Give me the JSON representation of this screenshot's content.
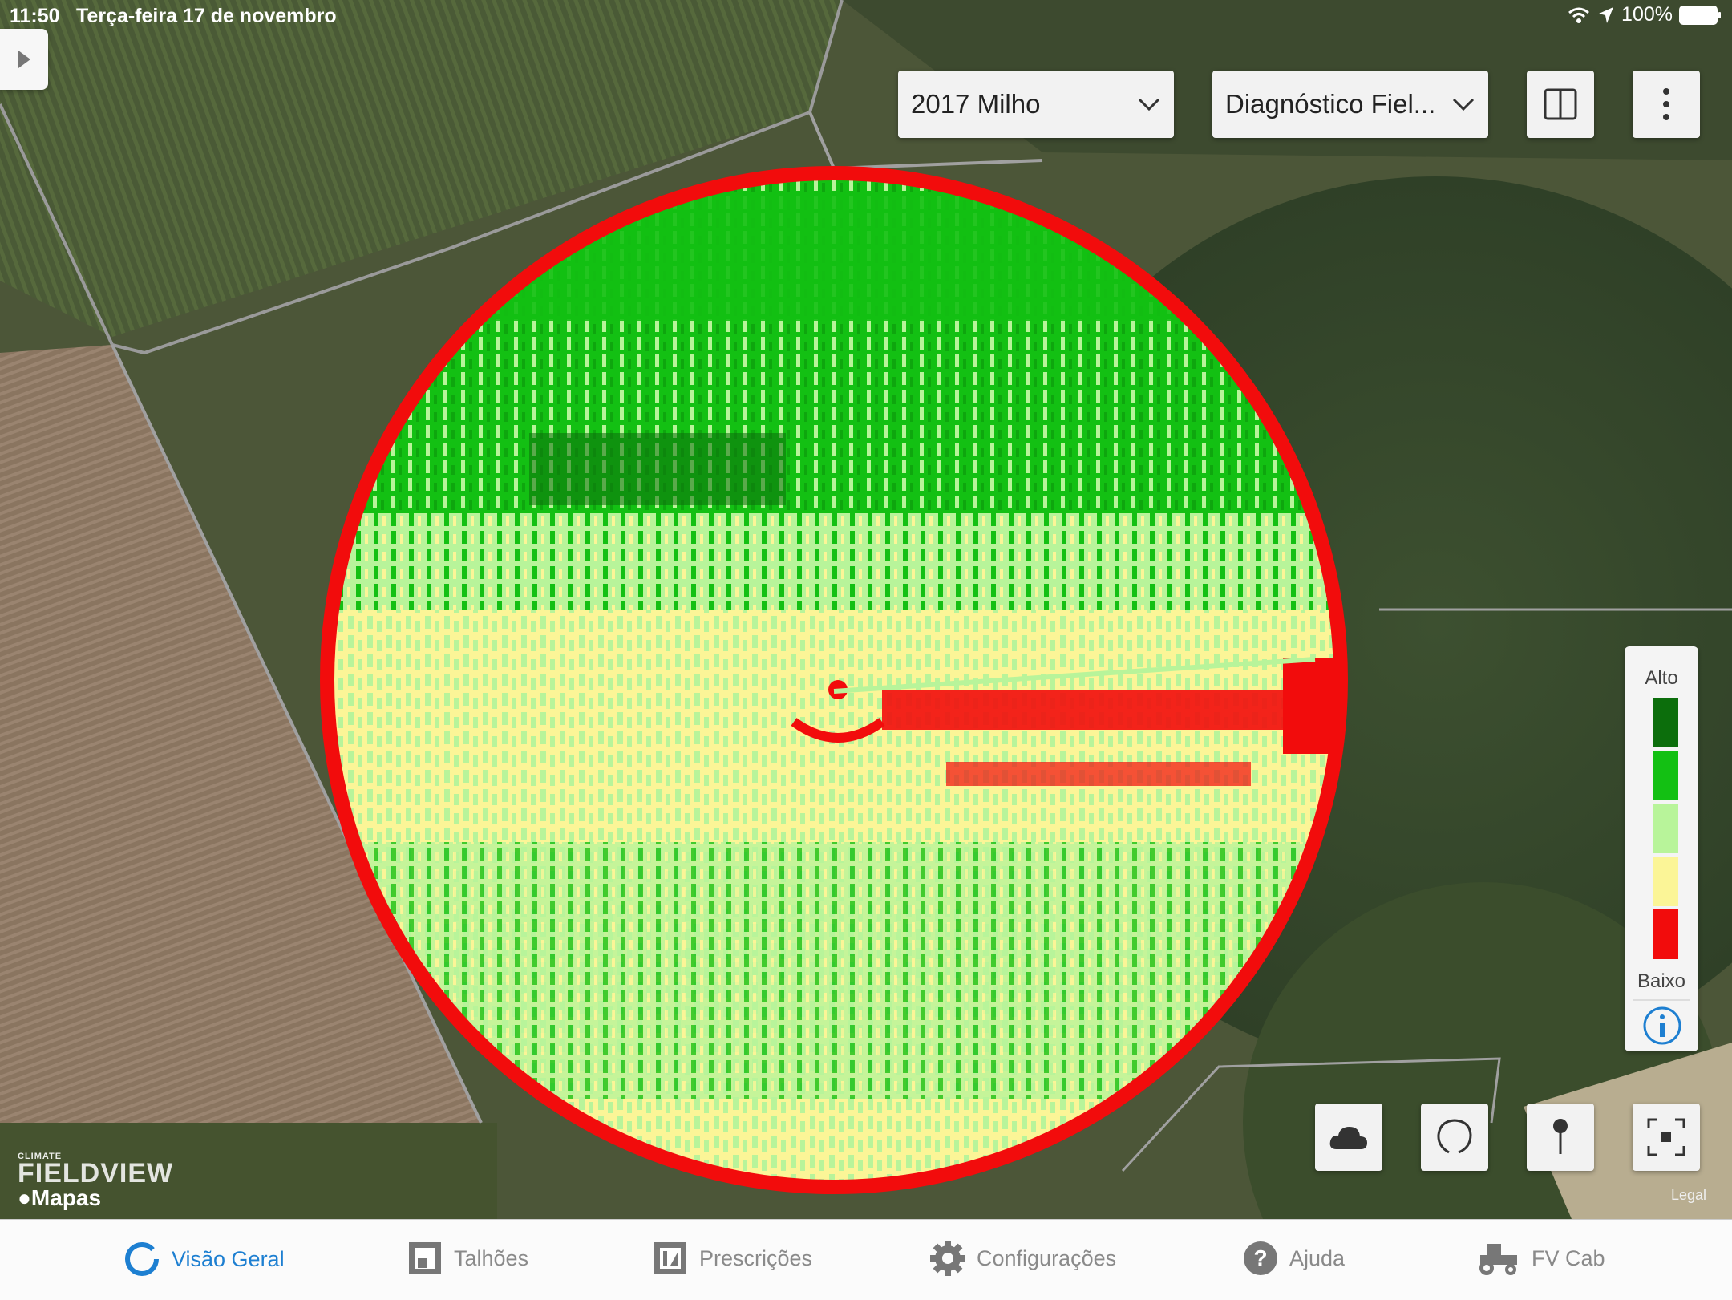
{
  "status": {
    "time": "11:50",
    "date": "Terça-feira 17 de novembro",
    "battery": "100%"
  },
  "toolbar": {
    "season_dropdown": "2017 Milho",
    "layer_dropdown": "Diagnóstico Fiel...",
    "split_view_icon": "split-view-icon",
    "more_icon": "more-vertical-icon"
  },
  "legend": {
    "high_label": "Alto",
    "low_label": "Baixo",
    "colors": [
      "#0c6e0c",
      "#13c013",
      "#b8f49a",
      "#fbf597",
      "#f20c0c"
    ]
  },
  "map": {
    "brand_small": "CLIMATE",
    "brand": "FIELDVIEW",
    "provider": "Mapas",
    "legal": "Legal"
  },
  "tabs": [
    {
      "label": "Visão Geral",
      "icon": "overview-icon",
      "active": true
    },
    {
      "label": "Talhões",
      "icon": "fields-icon",
      "active": false
    },
    {
      "label": "Prescrições",
      "icon": "prescriptions-icon",
      "active": false
    },
    {
      "label": "Configurações",
      "icon": "gear-icon",
      "active": false
    },
    {
      "label": "Ajuda",
      "icon": "help-icon",
      "active": false
    },
    {
      "label": "FV Cab",
      "icon": "tractor-icon",
      "active": false
    }
  ]
}
